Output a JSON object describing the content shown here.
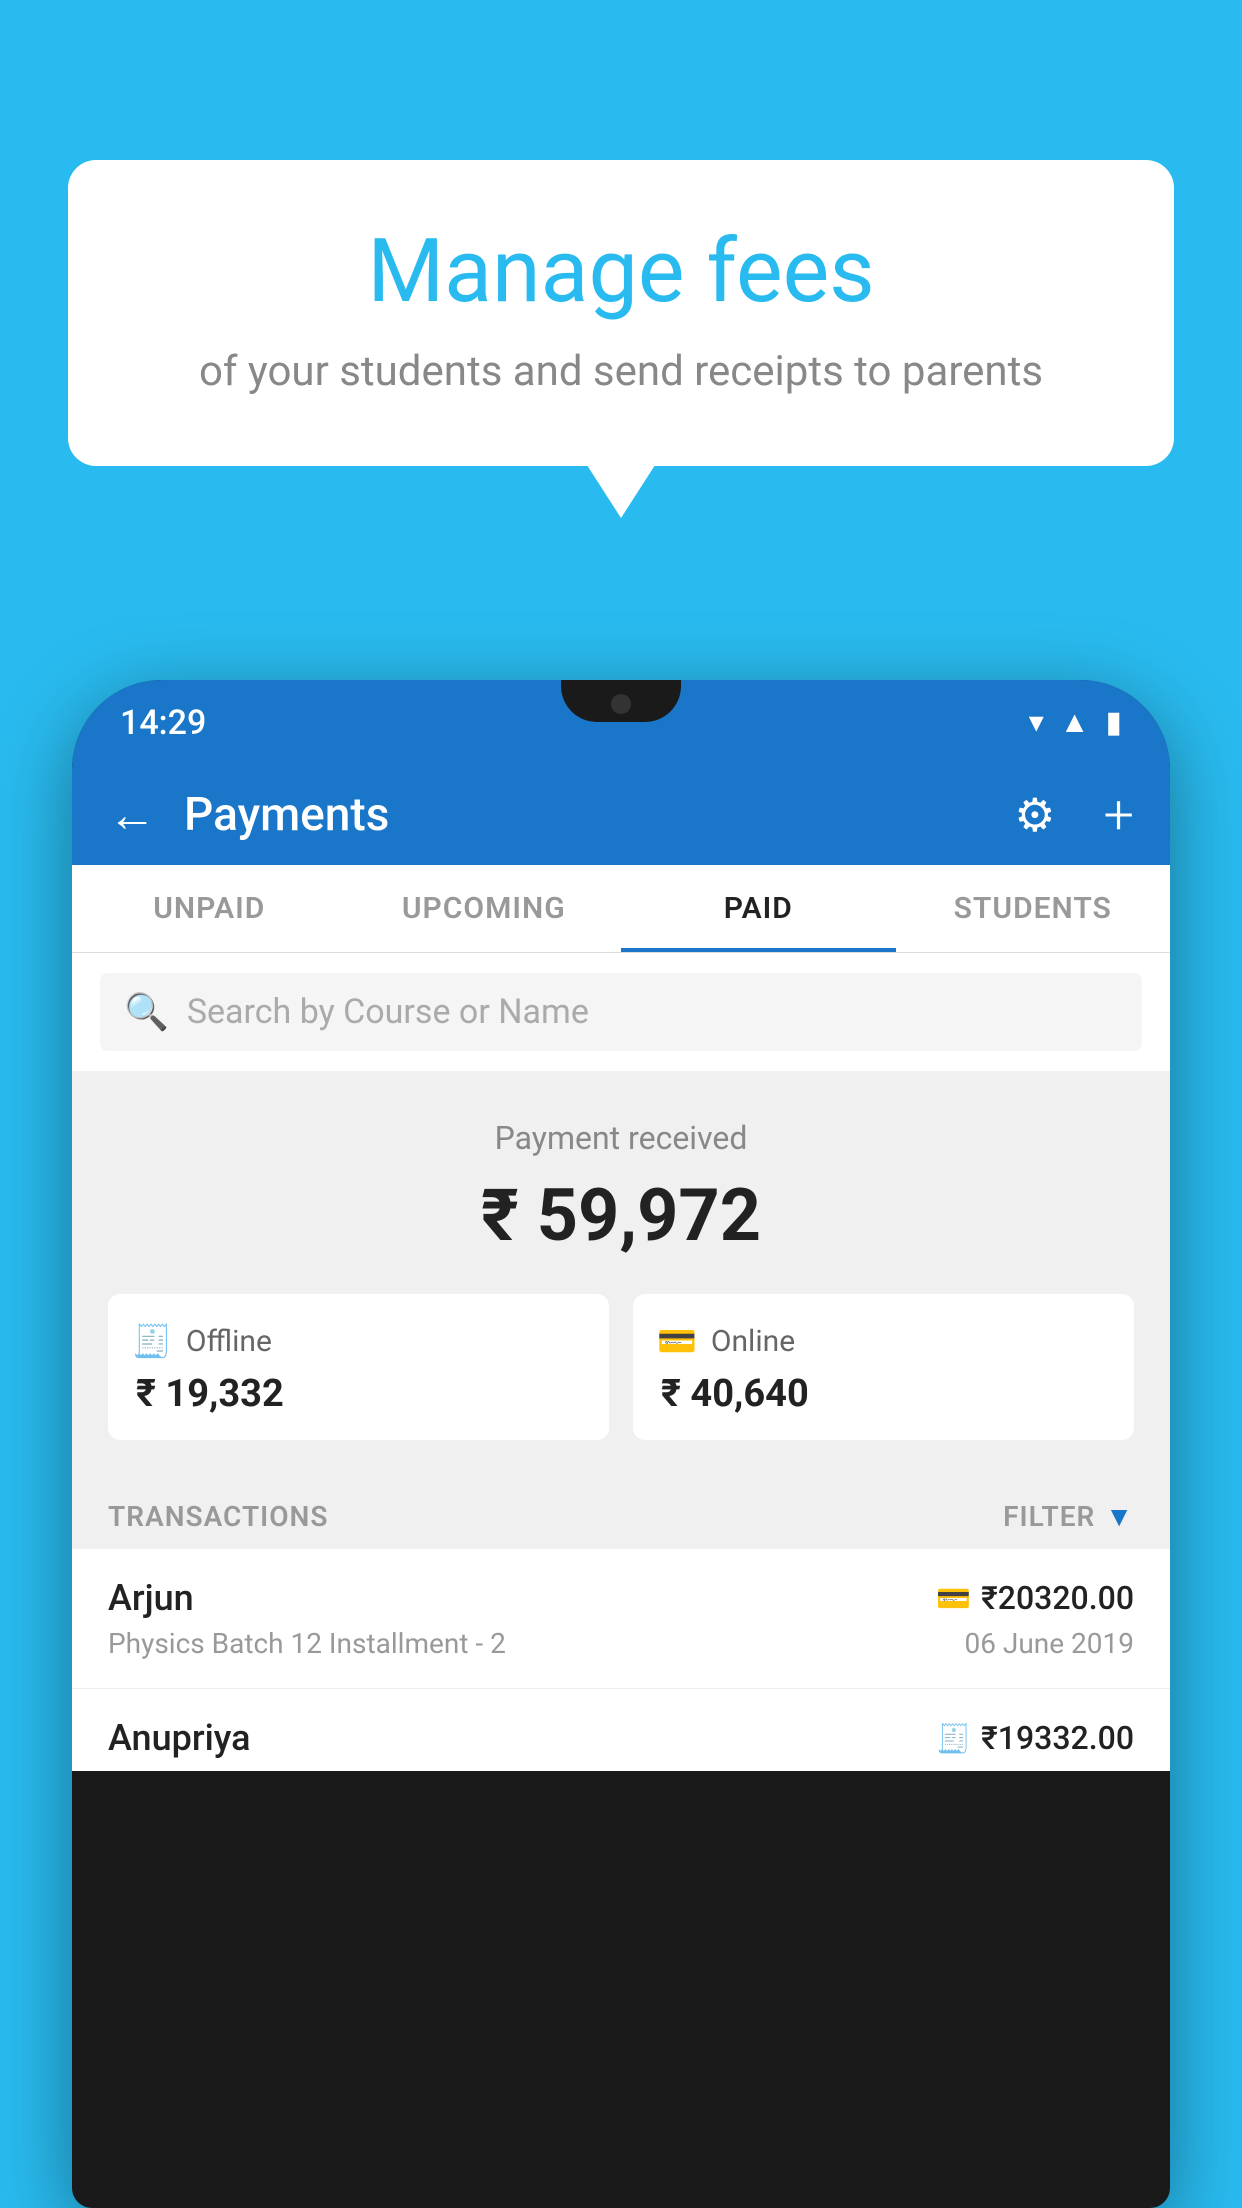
{
  "background_color": "#29BBEF",
  "bubble": {
    "title": "Manage fees",
    "subtitle": "of your students and send receipts to parents"
  },
  "status_bar": {
    "time": "14:29"
  },
  "header": {
    "title": "Payments",
    "back_label": "←",
    "gear_label": "⚙",
    "plus_label": "+"
  },
  "tabs": [
    {
      "id": "unpaid",
      "label": "UNPAID",
      "active": false
    },
    {
      "id": "upcoming",
      "label": "UPCOMING",
      "active": false
    },
    {
      "id": "paid",
      "label": "PAID",
      "active": true
    },
    {
      "id": "students",
      "label": "STUDENTS",
      "active": false
    }
  ],
  "search": {
    "placeholder": "Search by Course or Name"
  },
  "payment_summary": {
    "label": "Payment received",
    "total": "₹ 59,972",
    "offline": {
      "label": "Offline",
      "amount": "₹ 19,332"
    },
    "online": {
      "label": "Online",
      "amount": "₹ 40,640"
    }
  },
  "transactions": {
    "header_label": "TRANSACTIONS",
    "filter_label": "FILTER",
    "rows": [
      {
        "name": "Arjun",
        "course": "Physics Batch 12 Installment - 2",
        "amount": "₹20320.00",
        "date": "06 June 2019",
        "icon": "card"
      },
      {
        "name": "Anupriya",
        "course": "",
        "amount": "₹19332.00",
        "date": "",
        "icon": "cash"
      }
    ]
  }
}
